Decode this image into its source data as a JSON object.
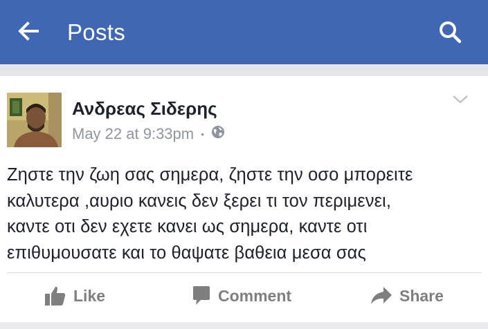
{
  "app_bar": {
    "title": "Posts",
    "back_icon": "arrow-left-icon",
    "search_icon": "search-icon",
    "color": "#4267b2"
  },
  "post": {
    "author": "Ανδρεας Σιδερης",
    "timestamp": "May 22 at 9:33pm",
    "separator": "•",
    "privacy_icon": "globe-icon",
    "menu_icon": "chevron-down-icon",
    "text_lines": [
      "Ζηστε την ζωη σας σημερα, ζηστε την οσο μπορειτε",
      "καλυτερα ,αυριο κανεις δεν ξερει τι τον περιμενει,",
      "καντε οτι δεν εχετε κανει ως σημερα, καντε οτι",
      "επιθυμουσατε και το θαψατε βαθεια μεσα σας"
    ]
  },
  "actions": {
    "like": "Like",
    "comment": "Comment",
    "share": "Share",
    "color": "#7f7f7f"
  }
}
